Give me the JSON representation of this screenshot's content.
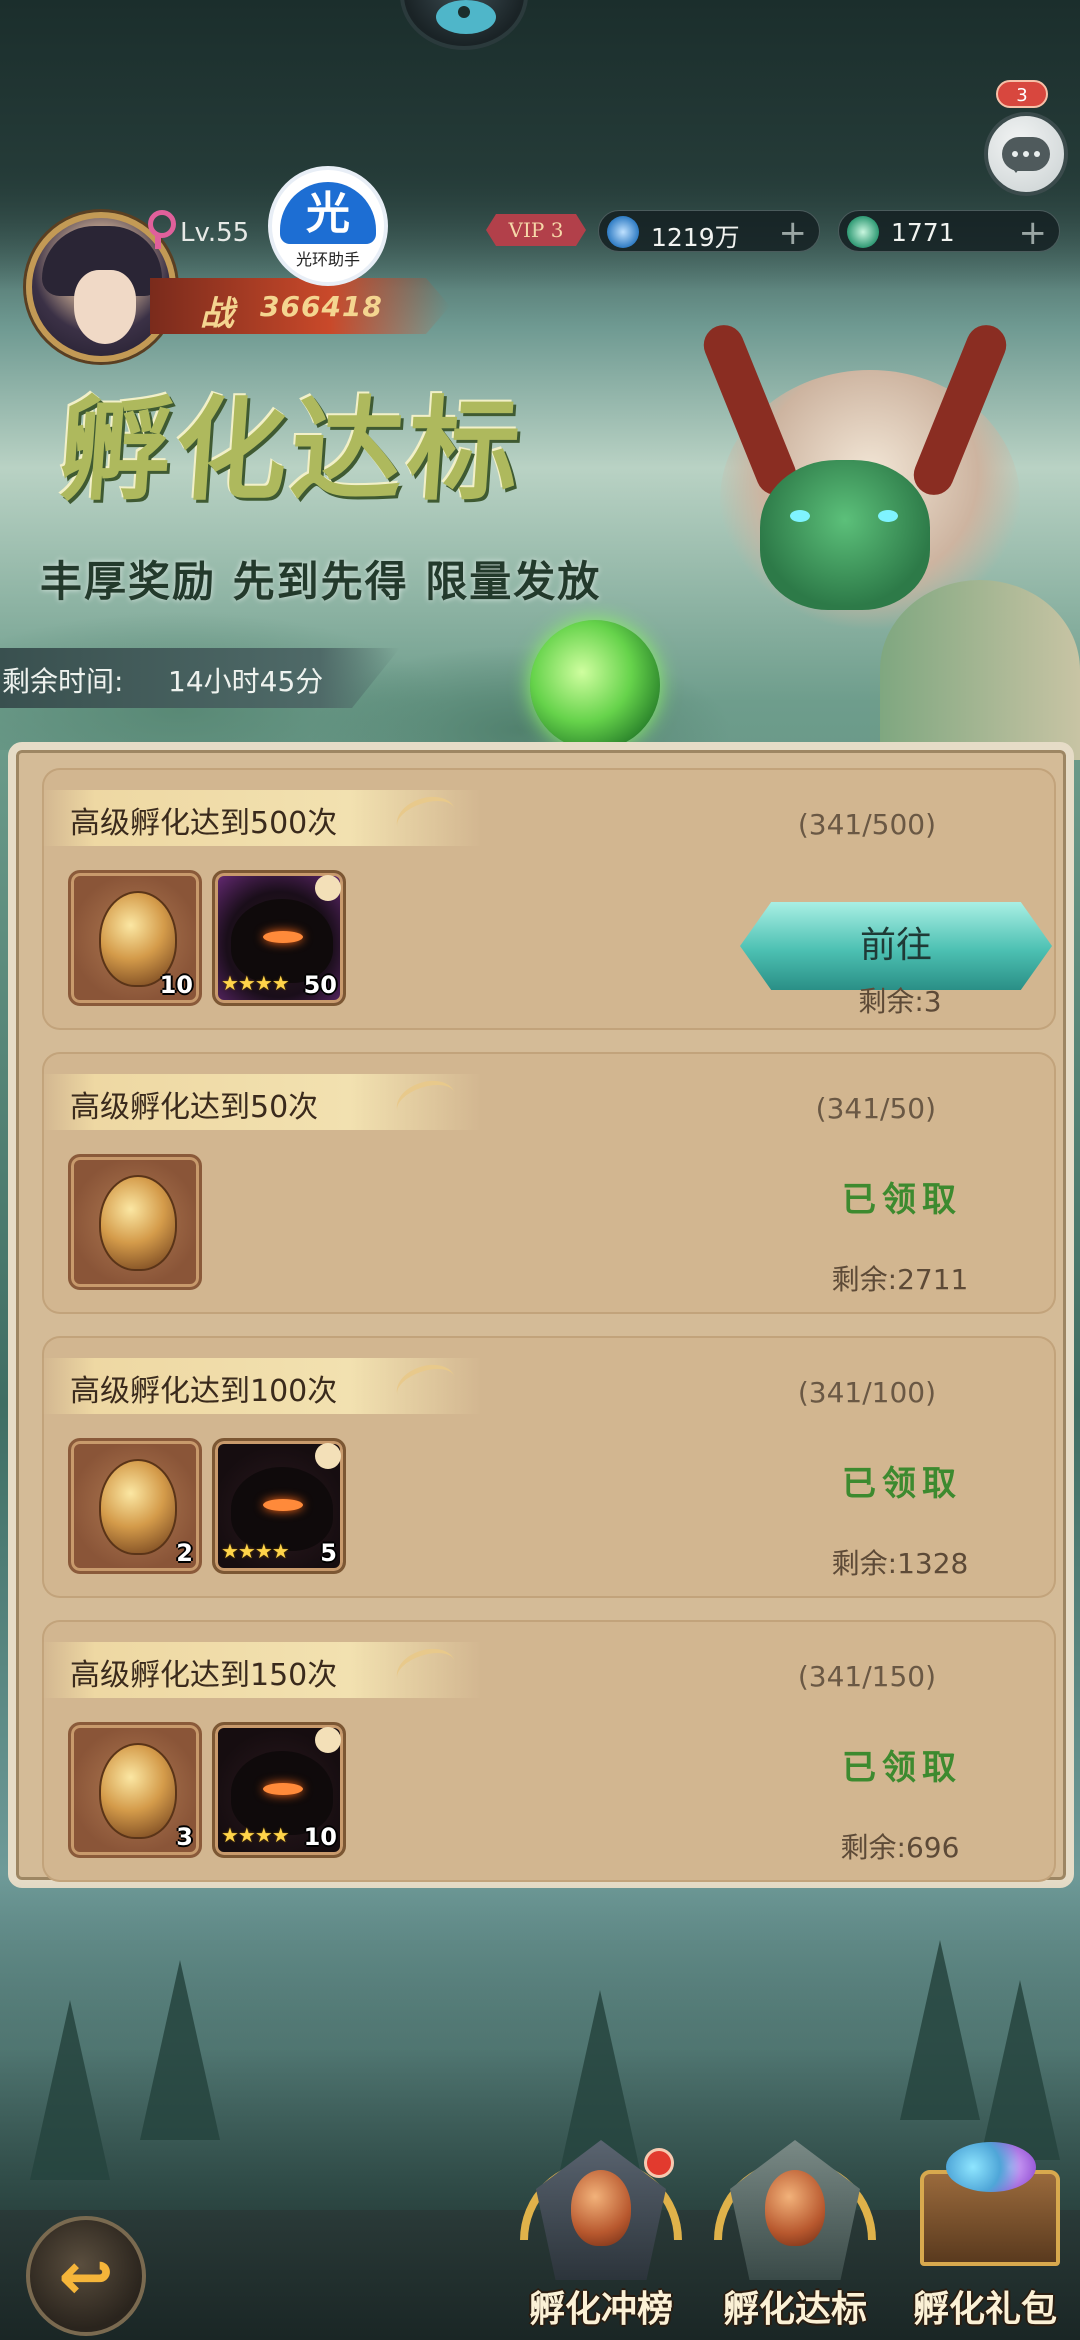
{
  "header": {
    "level": "Lv.55",
    "vip": "VIP 3",
    "helper_label": "光环助手",
    "helper_glyph": "光",
    "power_glyph": "战",
    "power_value": "366418",
    "currency1": "1219万",
    "currency2": "1771",
    "plus": "+",
    "chat_badge": "3"
  },
  "banner": {
    "title": "孵化达标",
    "subtitle": "丰厚奖励  先到先得  限量发放",
    "time_label": "剩余时间:",
    "time_value": "14小时45分"
  },
  "tasks": [
    {
      "title": "高级孵化达到500次",
      "progress": "(341/500)",
      "rewards": [
        {
          "type": "egg",
          "qty": "10"
        },
        {
          "type": "beast",
          "qty": "50",
          "stars": "★★★★"
        }
      ],
      "action": "前往",
      "remaining": "剩余:3"
    },
    {
      "title": "高级孵化达到50次",
      "progress": "(341/50)",
      "rewards": [
        {
          "type": "egg",
          "qty": ""
        }
      ],
      "status": "已领取",
      "remaining": "剩余:2711"
    },
    {
      "title": "高级孵化达到100次",
      "progress": "(341/100)",
      "rewards": [
        {
          "type": "egg",
          "qty": "2"
        },
        {
          "type": "beast",
          "qty": "5",
          "stars": "★★★★"
        }
      ],
      "status": "已领取",
      "remaining": "剩余:1328"
    },
    {
      "title": "高级孵化达到150次",
      "progress": "(341/150)",
      "rewards": [
        {
          "type": "egg",
          "qty": "3"
        },
        {
          "type": "beast",
          "qty": "10",
          "stars": "★★★★"
        }
      ],
      "status": "已领取",
      "remaining": "剩余:696"
    }
  ],
  "nav": {
    "back_arrow": "↩",
    "items": [
      {
        "label": "孵化冲榜"
      },
      {
        "label": "孵化达标"
      },
      {
        "label": "孵化礼包"
      }
    ]
  },
  "colors": {
    "claimed": "#3d8a2f",
    "go_button": "#4cc0b2",
    "panel": "#d4bb97"
  }
}
